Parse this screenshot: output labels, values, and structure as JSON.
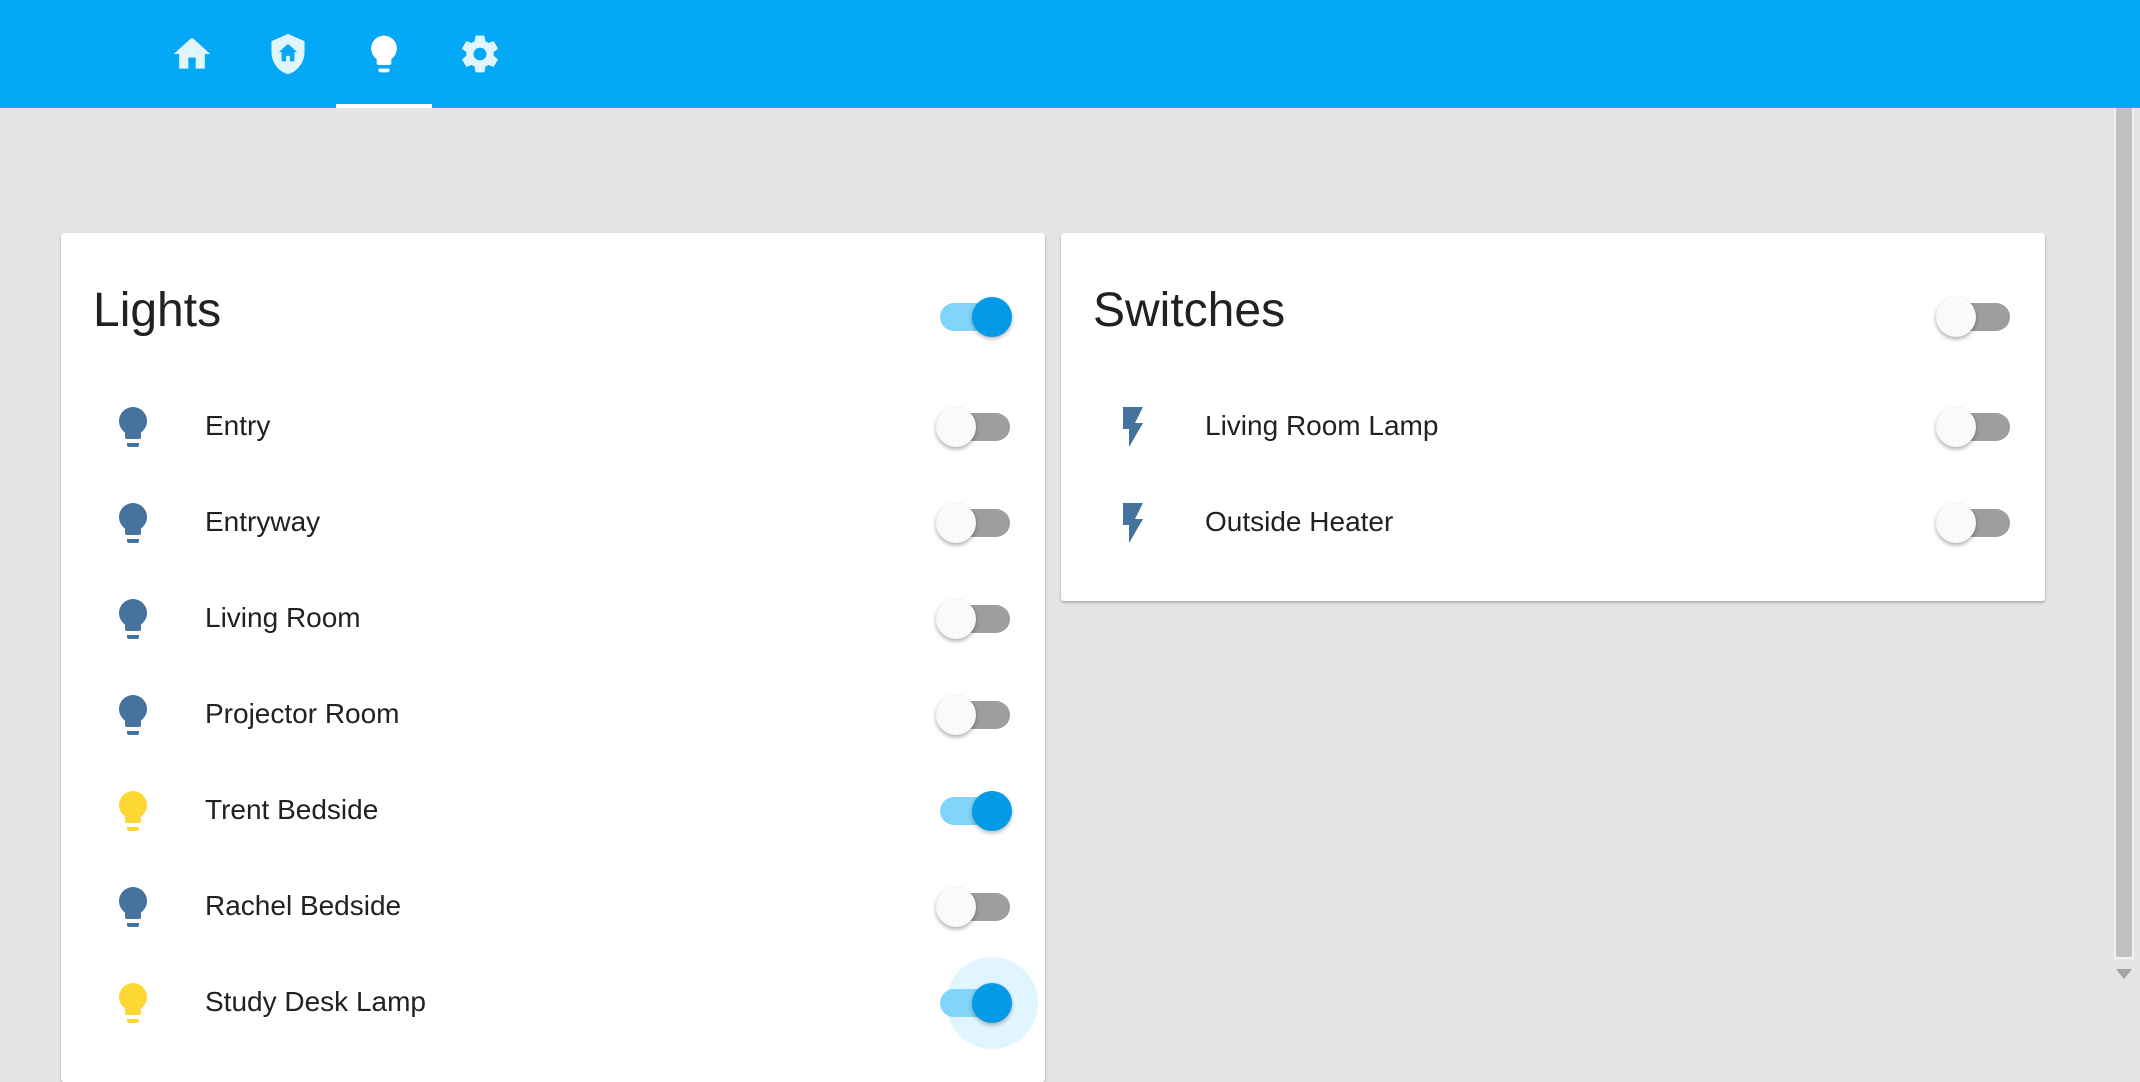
{
  "colors": {
    "header": "#03a9f4",
    "bulb_off": "#44739e",
    "bulb_on": "#fdd835",
    "toggle_on": "#039be5",
    "toggle_track_on": "#81d4fa",
    "toggle_track_off": "#9e9e9e"
  },
  "tabs": [
    {
      "icon": "home-icon",
      "active": false
    },
    {
      "icon": "home-shield-icon",
      "active": false
    },
    {
      "icon": "lightbulb-icon",
      "active": true
    },
    {
      "icon": "gear-icon",
      "active": false
    }
  ],
  "lights_card": {
    "title": "Lights",
    "master_on": true,
    "items": [
      {
        "label": "Entry",
        "icon": "lightbulb-icon",
        "on": false
      },
      {
        "label": "Entryway",
        "icon": "lightbulb-icon",
        "on": false
      },
      {
        "label": "Living Room",
        "icon": "lightbulb-icon",
        "on": false
      },
      {
        "label": "Projector Room",
        "icon": "lightbulb-icon",
        "on": false
      },
      {
        "label": "Trent Bedside",
        "icon": "lightbulb-icon",
        "on": true
      },
      {
        "label": "Rachel Bedside",
        "icon": "lightbulb-icon",
        "on": false
      },
      {
        "label": "Study Desk Lamp",
        "icon": "lightbulb-icon",
        "on": true
      }
    ]
  },
  "switches_card": {
    "title": "Switches",
    "master_on": false,
    "items": [
      {
        "label": "Living Room Lamp",
        "icon": "flash-icon",
        "on": false
      },
      {
        "label": "Outside Heater",
        "icon": "flash-icon",
        "on": false
      }
    ]
  }
}
